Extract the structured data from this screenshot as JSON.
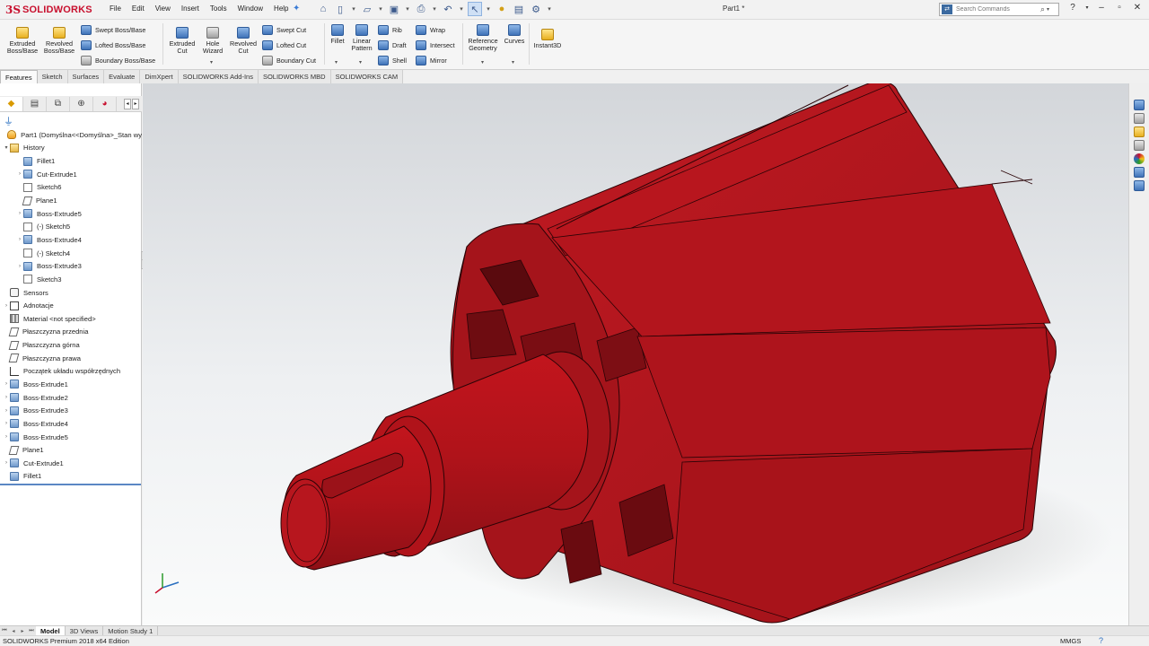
{
  "app": {
    "logo_ds": "3S",
    "logo_text": "SOLIDWORKS",
    "document_title": "Part1 *"
  },
  "menu": [
    "File",
    "Edit",
    "View",
    "Insert",
    "Tools",
    "Window",
    "Help"
  ],
  "search": {
    "placeholder": "Search Commands"
  },
  "ribbon": {
    "extruded_boss": [
      "Extruded",
      "Boss/Base"
    ],
    "revolved_boss": [
      "Revolved",
      "Boss/Base"
    ],
    "swept_boss": "Swept Boss/Base",
    "lofted_boss": "Lofted Boss/Base",
    "boundary_boss": "Boundary Boss/Base",
    "extruded_cut": [
      "Extruded",
      "Cut"
    ],
    "hole_wizard": [
      "Hole",
      "Wizard"
    ],
    "revolved_cut": [
      "Revolved",
      "Cut"
    ],
    "swept_cut": "Swept Cut",
    "lofted_cut": "Lofted Cut",
    "boundary_cut": "Boundary Cut",
    "fillet": "Fillet",
    "linear_pattern": [
      "Linear",
      "Pattern"
    ],
    "rib": "Rib",
    "draft": "Draft",
    "shell": "Shell",
    "wrap": "Wrap",
    "intersect": "Intersect",
    "mirror": "Mirror",
    "reference_geometry": [
      "Reference",
      "Geometry"
    ],
    "curves": "Curves",
    "instant3d": "Instant3D"
  },
  "command_tabs": [
    "Features",
    "Sketch",
    "Surfaces",
    "Evaluate",
    "DimXpert",
    "SOLIDWORKS Add-Ins",
    "SOLIDWORKS MBD",
    "SOLIDWORKS CAM"
  ],
  "feature_tree": [
    {
      "label": "Part1  (Domyślna<<Domyślna>_Stan wy",
      "icon": "part-icon",
      "indent": 0,
      "expander": ""
    },
    {
      "label": "History",
      "icon": "folder-icon",
      "indent": 0,
      "expander": "▾"
    },
    {
      "label": "Fillet1",
      "icon": "feature-icon",
      "indent": 1,
      "expander": ""
    },
    {
      "label": "Cut-Extrude1",
      "icon": "feature-icon",
      "indent": 1,
      "expander": "›"
    },
    {
      "label": "Sketch6",
      "icon": "sketch-icon",
      "indent": 1,
      "expander": ""
    },
    {
      "label": "Plane1",
      "icon": "plane-icon",
      "indent": 1,
      "expander": ""
    },
    {
      "label": "Boss-Extrude5",
      "icon": "feature-icon",
      "indent": 1,
      "expander": "›"
    },
    {
      "label": "(-) Sketch5",
      "icon": "sketch-icon",
      "indent": 1,
      "expander": ""
    },
    {
      "label": "Boss-Extrude4",
      "icon": "feature-icon",
      "indent": 1,
      "expander": "›"
    },
    {
      "label": "(-) Sketch4",
      "icon": "sketch-icon",
      "indent": 1,
      "expander": ""
    },
    {
      "label": "Boss-Extrude3",
      "icon": "feature-icon",
      "indent": 1,
      "expander": "›"
    },
    {
      "label": "Sketch3",
      "icon": "sketch-icon",
      "indent": 1,
      "expander": ""
    },
    {
      "label": "Sensors",
      "icon": "sensor-icon",
      "indent": 0,
      "expander": ""
    },
    {
      "label": "Adnotacje",
      "icon": "annotation-icon",
      "indent": 0,
      "expander": "›"
    },
    {
      "label": "Material <not specified>",
      "icon": "material-icon",
      "indent": 0,
      "expander": ""
    },
    {
      "label": "Płaszczyzna przednia",
      "icon": "plane-icon",
      "indent": 0,
      "expander": ""
    },
    {
      "label": "Płaszczyzna górna",
      "icon": "plane-icon",
      "indent": 0,
      "expander": ""
    },
    {
      "label": "Płaszczyzna prawa",
      "icon": "plane-icon",
      "indent": 0,
      "expander": ""
    },
    {
      "label": "Początek układu współrzędnych",
      "icon": "origin-icon",
      "indent": 0,
      "expander": ""
    },
    {
      "label": "Boss-Extrude1",
      "icon": "feature-icon",
      "indent": 0,
      "expander": "›"
    },
    {
      "label": "Boss-Extrude2",
      "icon": "feature-icon",
      "indent": 0,
      "expander": "›"
    },
    {
      "label": "Boss-Extrude3",
      "icon": "feature-icon",
      "indent": 0,
      "expander": "›"
    },
    {
      "label": "Boss-Extrude4",
      "icon": "feature-icon",
      "indent": 0,
      "expander": "›"
    },
    {
      "label": "Boss-Extrude5",
      "icon": "feature-icon",
      "indent": 0,
      "expander": "›"
    },
    {
      "label": "Plane1",
      "icon": "plane-icon",
      "indent": 0,
      "expander": ""
    },
    {
      "label": "Cut-Extrude1",
      "icon": "feature-icon",
      "indent": 0,
      "expander": "›"
    },
    {
      "label": "Fillet1",
      "icon": "feature-icon",
      "indent": 0,
      "expander": ""
    }
  ],
  "bottom_tabs": [
    "Model",
    "3D Views",
    "Motion Study 1"
  ],
  "status": {
    "edition": "SOLIDWORKS Premium 2018 x64 Edition",
    "units": "MMGS"
  },
  "colors": {
    "brand": "#c8102e",
    "model": "#b0161e",
    "accent": "#3f72b8"
  }
}
